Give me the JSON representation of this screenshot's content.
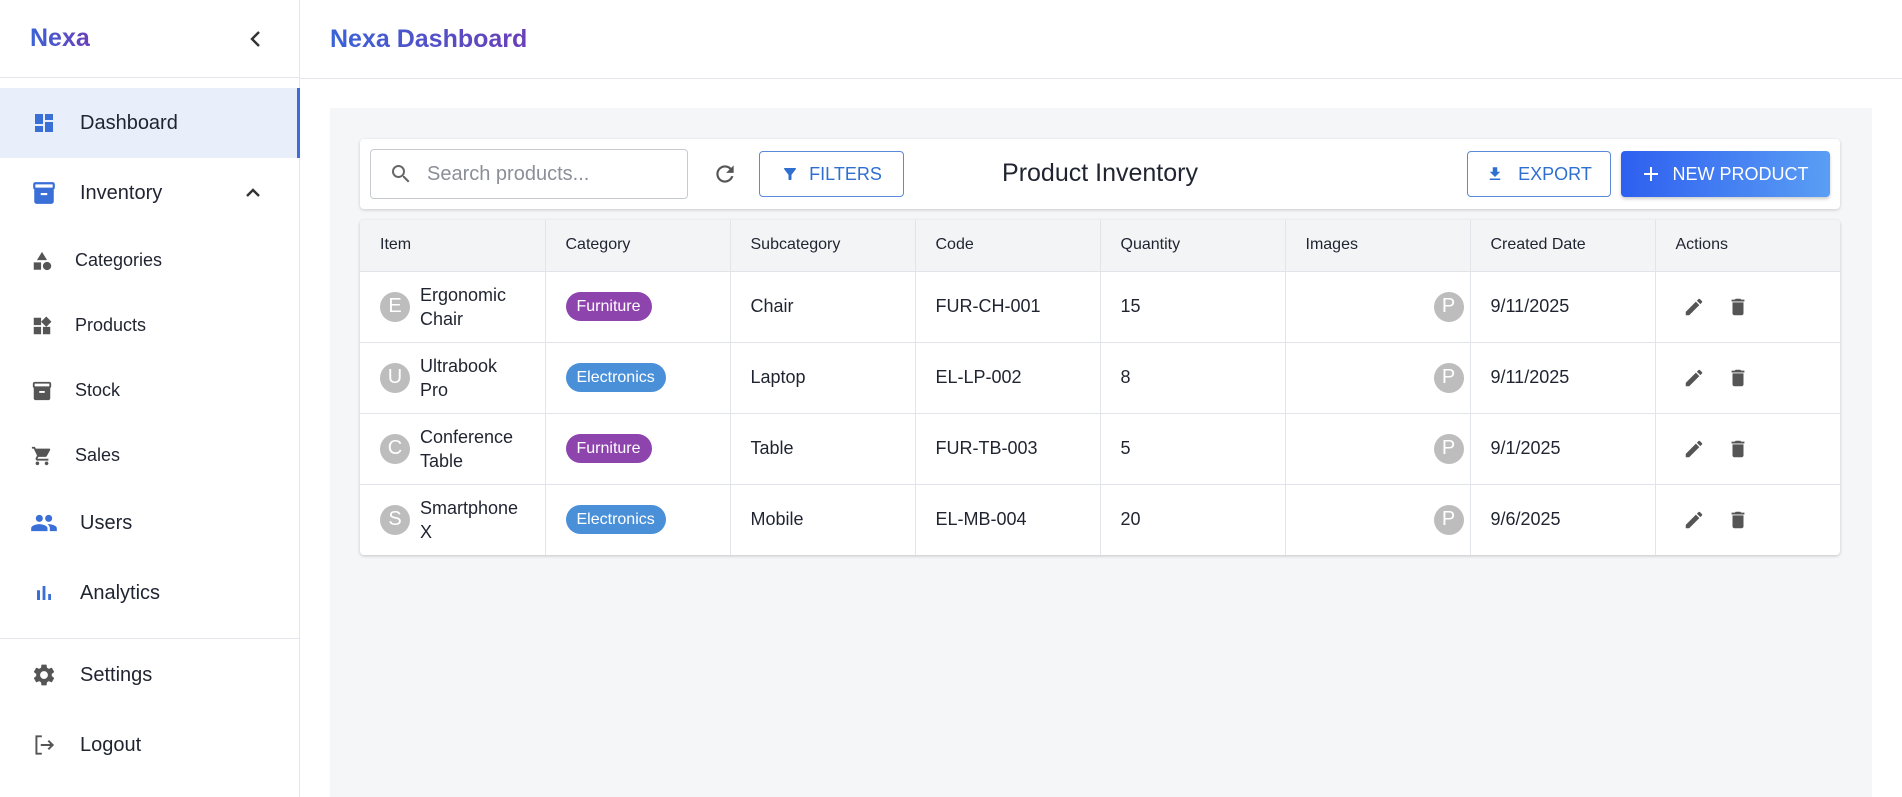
{
  "app": {
    "brand": "Nexa",
    "header_title": "Nexa Dashboard"
  },
  "colors": {
    "accent": "#3a6fd8",
    "furniture_chip": "#8e44ad",
    "electronics_chip": "#4a90d9",
    "active_bg": "#e8effb"
  },
  "sidebar": {
    "items": [
      {
        "label": "Dashboard",
        "icon": "dashboard-icon",
        "active": true
      },
      {
        "label": "Inventory",
        "icon": "inventory-icon",
        "expanded": true
      },
      {
        "label": "Users",
        "icon": "users-icon"
      },
      {
        "label": "Analytics",
        "icon": "bar-chart-icon"
      }
    ],
    "sub_items": [
      {
        "label": "Categories",
        "icon": "shapes-icon"
      },
      {
        "label": "Products",
        "icon": "widgets-icon"
      },
      {
        "label": "Stock",
        "icon": "archive-icon"
      },
      {
        "label": "Sales",
        "icon": "cart-icon"
      }
    ],
    "bottom": [
      {
        "label": "Settings",
        "icon": "gear-icon"
      },
      {
        "label": "Logout",
        "icon": "logout-icon"
      }
    ]
  },
  "toolbar": {
    "search_placeholder": "Search products...",
    "filters_label": "FILTERS",
    "title": "Product Inventory",
    "export_label": "EXPORT",
    "new_product_label": "NEW PRODUCT"
  },
  "table": {
    "columns": [
      "Item",
      "Category",
      "Subcategory",
      "Code",
      "Quantity",
      "Images",
      "Created Date",
      "Actions"
    ],
    "rows": [
      {
        "initial": "E",
        "name": "Ergonomic Chair",
        "category": "Furniture",
        "subcategory": "Chair",
        "code": "FUR-CH-001",
        "quantity": "15",
        "image_initial": "P",
        "created": "9/11/2025"
      },
      {
        "initial": "U",
        "name": "Ultrabook Pro",
        "category": "Electronics",
        "subcategory": "Laptop",
        "code": "EL-LP-002",
        "quantity": "8",
        "image_initial": "P",
        "created": "9/11/2025"
      },
      {
        "initial": "C",
        "name": "Conference Table",
        "category": "Furniture",
        "subcategory": "Table",
        "code": "FUR-TB-003",
        "quantity": "5",
        "image_initial": "P",
        "created": "9/1/2025"
      },
      {
        "initial": "S",
        "name": "Smartphone X",
        "category": "Electronics",
        "subcategory": "Mobile",
        "code": "EL-MB-004",
        "quantity": "20",
        "image_initial": "P",
        "created": "9/6/2025"
      }
    ]
  }
}
